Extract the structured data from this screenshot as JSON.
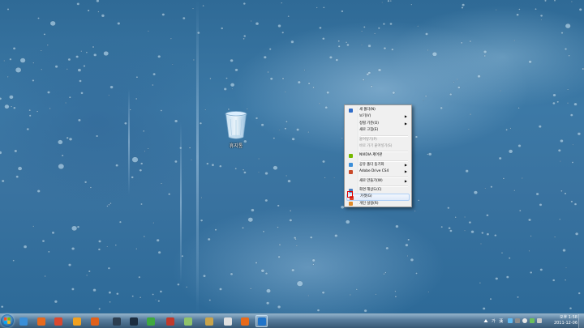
{
  "desktop": {
    "icons": [
      {
        "label": "휴지통",
        "icon": "recycle-bin-icon"
      }
    ]
  },
  "context_menu": {
    "items": [
      {
        "label": "새 폴더(N)",
        "icon": "new-folder-icon",
        "submenu": false,
        "disabled": false
      },
      {
        "label": "보기(V)",
        "icon": "",
        "submenu": true,
        "disabled": false
      },
      {
        "label": "정렬 기준(O)",
        "icon": "",
        "submenu": true,
        "disabled": false
      },
      {
        "label": "새로 고침(E)",
        "icon": "",
        "submenu": false,
        "disabled": false
      },
      {
        "separator": true
      },
      {
        "label": "붙여넣기(P)",
        "icon": "",
        "submenu": false,
        "disabled": true
      },
      {
        "label": "바로 가기 붙여넣기(S)",
        "icon": "",
        "submenu": false,
        "disabled": true
      },
      {
        "separator": true
      },
      {
        "label": "NVIDIA 제어판",
        "icon": "nvidia-icon",
        "submenu": false,
        "disabled": false
      },
      {
        "separator": true
      },
      {
        "label": "공유 폴더 동기화",
        "icon": "sync-icon",
        "submenu": true,
        "disabled": false
      },
      {
        "label": "Adobe Drive CS4",
        "icon": "adobe-drive-icon",
        "submenu": true,
        "disabled": false
      },
      {
        "separator": true
      },
      {
        "label": "새로 만들기(W)",
        "icon": "",
        "submenu": true,
        "disabled": false
      },
      {
        "separator": true
      },
      {
        "label": "화면 해상도(C)",
        "icon": "display-icon",
        "submenu": false,
        "disabled": false
      },
      {
        "label": "가젯(G)",
        "icon": "gadget-icon",
        "submenu": false,
        "disabled": false,
        "highlighted": true
      },
      {
        "label": "개인 설정(R)",
        "icon": "personalize-icon",
        "submenu": false,
        "disabled": false
      }
    ],
    "colors": {
      "background": "#f0f0f0",
      "highlight_border": "#aecff7",
      "annotation_box": "#e00000"
    }
  },
  "taskbar": {
    "apps": [
      {
        "name": "ie-icon",
        "color": "#3a8fd8"
      },
      {
        "name": "firefox-icon",
        "color": "#e66a1e"
      },
      {
        "name": "chrome-icon",
        "color": "#d9482f"
      },
      {
        "name": "player-icon",
        "color": "#f0a020"
      },
      {
        "name": "check-app-icon",
        "color": "#e0601a"
      },
      {
        "name": "terminal-icon",
        "color": "#2c3e50"
      },
      {
        "name": "monitor-app-icon",
        "color": "#1c2d40"
      },
      {
        "name": "torrent-icon",
        "color": "#3fa83f"
      },
      {
        "name": "paint-icon",
        "color": "#c0392b"
      },
      {
        "name": "notes-icon",
        "color": "#8fc26a"
      },
      {
        "name": "tools-icon",
        "color": "#c9a34a"
      },
      {
        "name": "media-icon",
        "color": "#e0e0e0"
      },
      {
        "name": "k-app-icon",
        "color": "#e86a1a"
      },
      {
        "name": "photoshop-icon",
        "color": "#1f73c9"
      }
    ],
    "tray": {
      "language": "가",
      "ime": "漢",
      "time": "오후 1:58",
      "date": "2011-12-06"
    }
  }
}
